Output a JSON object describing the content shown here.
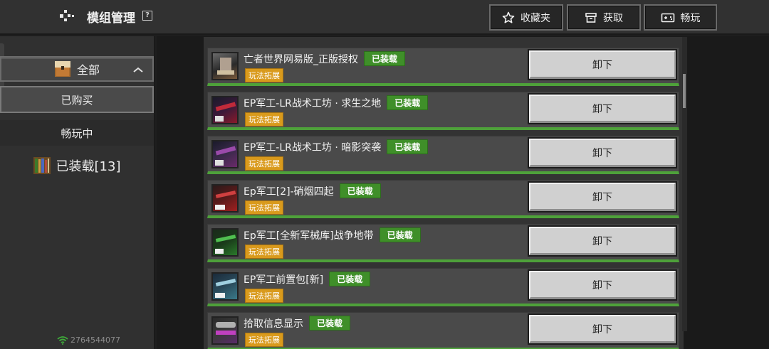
{
  "header": {
    "title": "模组管理",
    "help": "?",
    "favorites_label": "收藏夹",
    "get_label": "获取",
    "play_label": "畅玩"
  },
  "sidebar": {
    "all_label": "全部",
    "bought_label": "已购买",
    "play_label": "畅玩中",
    "installed_label": "已装载[13]",
    "uid": "2764544077"
  },
  "mods": [
    {
      "name": "亡者世界网易版_正版授权",
      "status": "已装载",
      "tag": "玩法拓展",
      "action": "卸下"
    },
    {
      "name": "EP军工-LR战术工坊 · 求生之地",
      "status": "已装载",
      "tag": "玩法拓展",
      "action": "卸下"
    },
    {
      "name": "EP军工-LR战术工坊 · 暗影突袭",
      "status": "已装载",
      "tag": "玩法拓展",
      "action": "卸下"
    },
    {
      "name": "Ep军工[2]-硝烟四起",
      "status": "已装载",
      "tag": "玩法拓展",
      "action": "卸下"
    },
    {
      "name": "Ep军工[全新军械库]战争地带",
      "status": "已装载",
      "tag": "玩法拓展",
      "action": "卸下"
    },
    {
      "name": "EP军工前置包[新]",
      "status": "已装载",
      "tag": "玩法拓展",
      "action": "卸下"
    },
    {
      "name": "拾取信息显示",
      "status": "已装载",
      "tag": "玩法拓展",
      "action": "卸下"
    }
  ],
  "colors": {
    "installed_badge": "#3f8f29",
    "tag": "#d99a1c",
    "card_underline": "#4ea13a"
  }
}
